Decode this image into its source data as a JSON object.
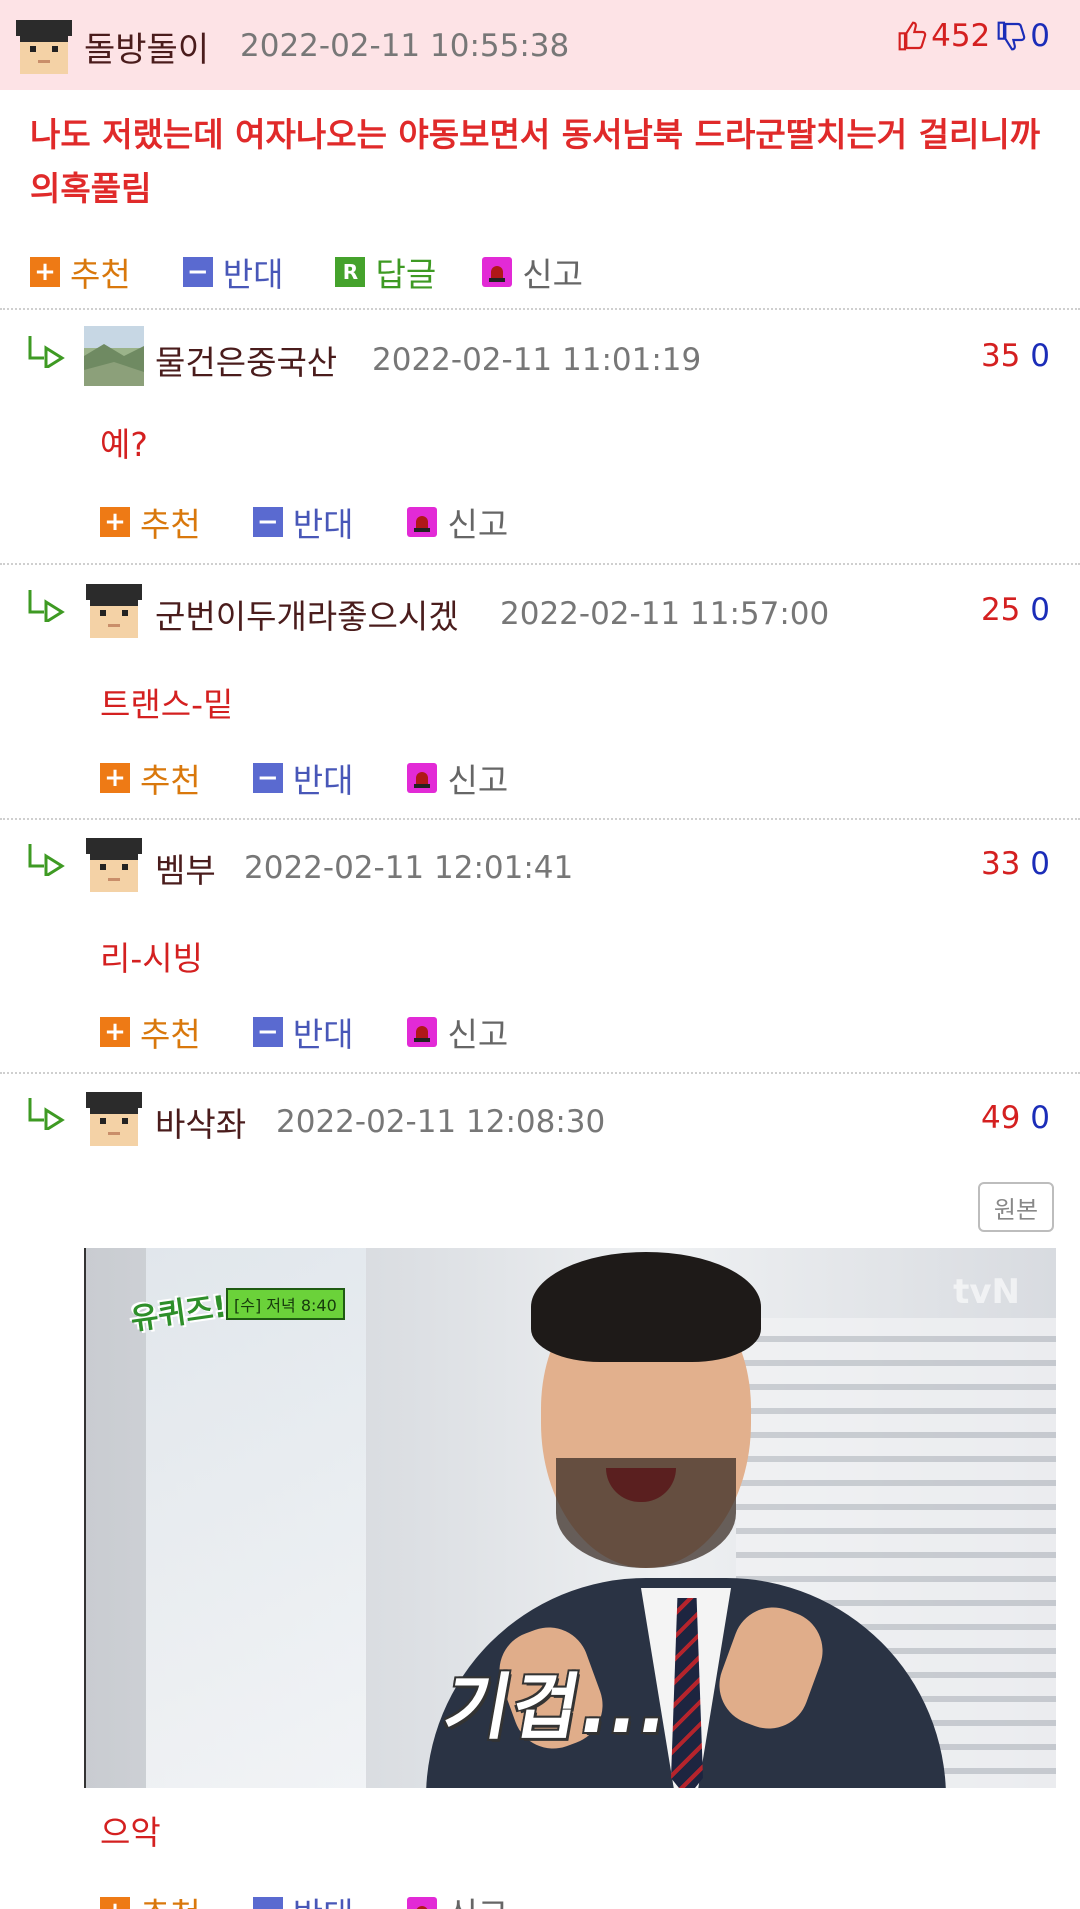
{
  "best": {
    "nickname": "돌방돌이",
    "datetime": "2022-02-11 10:55:38",
    "up_count": "452",
    "down_count": "0",
    "body": "나도 저랬는데 여자나오는 야동보면서 동서남북 드라군딸치는거 걸리니까 의혹풀림"
  },
  "actions": {
    "upvote": "추천",
    "downvote": "반대",
    "reply": "답글",
    "report": "신고",
    "reply_icon": "R"
  },
  "comments": [
    {
      "nickname": "물건은중국산",
      "datetime": "2022-02-11 11:01:19",
      "up": "35",
      "down": "0",
      "text": "예?"
    },
    {
      "nickname": "군번이두개라좋으시겠",
      "datetime": "2022-02-11 11:57:00",
      "up": "25",
      "down": "0",
      "text": "트랜스-밑"
    },
    {
      "nickname": "벰부",
      "datetime": "2022-02-11 12:01:41",
      "up": "33",
      "down": "0",
      "text": "리-시빙"
    },
    {
      "nickname": "바삭좌",
      "datetime": "2022-02-11 12:08:30",
      "up": "49",
      "down": "0",
      "text": "으악"
    }
  ],
  "original_button": "원본",
  "image": {
    "show_logo": "유퀴즈!",
    "show_badge": "[수] 저녁 8:40",
    "watermark": "tvN",
    "caption": "기겁..."
  },
  "icons": [
    "avatar-icon",
    "thumbs-up-icon",
    "thumbs-down-icon",
    "reply-arrow-icon",
    "plus-icon",
    "minus-icon",
    "reply-icon",
    "siren-icon"
  ],
  "colors": {
    "header_bg": "#fde3e6",
    "up_red": "#d42020",
    "down_blue": "#1b2db8",
    "comment_text": "#d42020",
    "upvote_orange": "#ee7a15",
    "downvote_blue": "#5a6ad0",
    "reply_green": "#45a22c",
    "report_magenta": "#e22ad6"
  }
}
